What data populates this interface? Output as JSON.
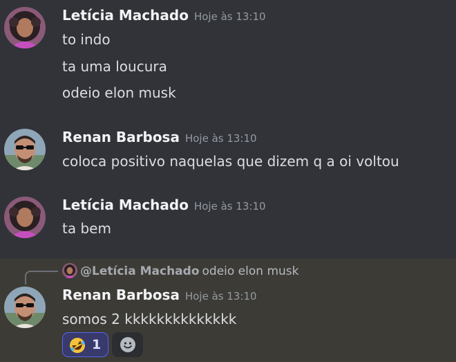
{
  "messages": [
    {
      "author": "Letícia Machado",
      "timestamp": "Hoje às 13:10",
      "lines": [
        "to indo",
        "ta uma loucura",
        "odeio elon musk"
      ],
      "avatar": "avatar-leticia"
    },
    {
      "author": "Renan Barbosa",
      "timestamp": "Hoje às 13:10",
      "lines": [
        "coloca positivo naquelas que dizem q a oi voltou"
      ],
      "avatar": "avatar-renan"
    },
    {
      "author": "Letícia Machado",
      "timestamp": "Hoje às 13:10",
      "lines": [
        "ta bem"
      ],
      "avatar": "avatar-leticia"
    },
    {
      "author": "Renan Barbosa",
      "timestamp": "Hoje às 13:10",
      "lines": [
        "somos 2 kkkkkkkkkkkkkk"
      ],
      "avatar": "avatar-renan",
      "reply": {
        "author": "@Letícia Machado",
        "text": "odeio elon musk"
      },
      "reactions": [
        {
          "emoji": "rolling-on-floor-laughing-icon",
          "count": "1",
          "active": true
        }
      ],
      "add_reaction_icon": "add-reaction-icon"
    }
  ],
  "colors": {
    "background": "#313338",
    "highlight": "#3d3b36",
    "author": "#f2f3f5",
    "timestamp": "#949ba4",
    "text": "#dbdee1",
    "reaction_active_bg": "#373a6b",
    "reaction_active_border": "#5865f2"
  }
}
